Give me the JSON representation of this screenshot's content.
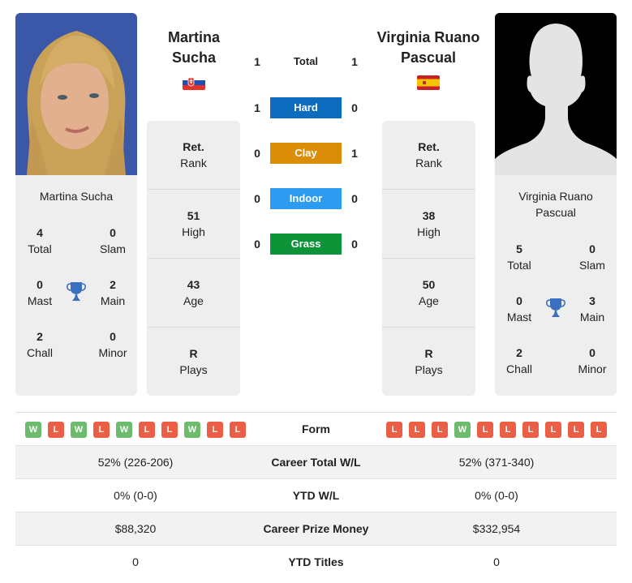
{
  "players": {
    "left": {
      "name": "Martina Sucha",
      "name_line1": "Martina",
      "name_line2": "Sucha",
      "country": "Slovakia",
      "flag_icon": "slovakia-flag-icon",
      "titles": {
        "total": {
          "value": "4",
          "label": "Total"
        },
        "slam": {
          "value": "0",
          "label": "Slam"
        },
        "mast": {
          "value": "0",
          "label": "Mast"
        },
        "main": {
          "value": "2",
          "label": "Main"
        },
        "chall": {
          "value": "2",
          "label": "Chall"
        },
        "minor": {
          "value": "0",
          "label": "Minor"
        }
      },
      "rank": {
        "value": "Ret.",
        "label": "Rank"
      },
      "high": {
        "value": "51",
        "label": "High"
      },
      "age": {
        "value": "43",
        "label": "Age"
      },
      "plays": {
        "value": "R",
        "label": "Plays"
      },
      "form": [
        "W",
        "L",
        "W",
        "L",
        "W",
        "L",
        "L",
        "W",
        "L",
        "L"
      ],
      "career_wl": "52% (226-206)",
      "ytd_wl": "0% (0-0)",
      "prize_money": "$88,320",
      "ytd_titles": "0"
    },
    "right": {
      "name": "Virginia Ruano Pascual",
      "name_line1": "Virginia Ruano",
      "name_line2": "Pascual",
      "country": "Spain",
      "flag_icon": "spain-flag-icon",
      "titles": {
        "total": {
          "value": "5",
          "label": "Total"
        },
        "slam": {
          "value": "0",
          "label": "Slam"
        },
        "mast": {
          "value": "0",
          "label": "Mast"
        },
        "main": {
          "value": "3",
          "label": "Main"
        },
        "chall": {
          "value": "2",
          "label": "Chall"
        },
        "minor": {
          "value": "0",
          "label": "Minor"
        }
      },
      "rank": {
        "value": "Ret.",
        "label": "Rank"
      },
      "high": {
        "value": "38",
        "label": "High"
      },
      "age": {
        "value": "50",
        "label": "Age"
      },
      "plays": {
        "value": "R",
        "label": "Plays"
      },
      "form": [
        "L",
        "L",
        "L",
        "W",
        "L",
        "L",
        "L",
        "L",
        "L",
        "L"
      ],
      "career_wl": "52% (371-340)",
      "ytd_wl": "0% (0-0)",
      "prize_money": "$332,954",
      "ytd_titles": "0"
    }
  },
  "h2h": [
    {
      "label": "Total",
      "left": "1",
      "right": "1",
      "color": ""
    },
    {
      "label": "Hard",
      "left": "1",
      "right": "0",
      "color": "#0d6cbd"
    },
    {
      "label": "Clay",
      "left": "0",
      "right": "1",
      "color": "#dc8d08"
    },
    {
      "label": "Indoor",
      "left": "0",
      "right": "0",
      "color": "#2d9bef"
    },
    {
      "label": "Grass",
      "left": "0",
      "right": "0",
      "color": "#0f9339"
    }
  ],
  "comparison": {
    "form_label": "Form",
    "career_wl_label": "Career Total W/L",
    "ytd_wl_label": "YTD W/L",
    "prize_label": "Career Prize Money",
    "ytd_titles_label": "YTD Titles"
  },
  "colors": {
    "win": "#6dbb6d",
    "loss": "#ec5f47",
    "trophy": "#3b6fbf",
    "card_bg": "#eeeeee"
  }
}
